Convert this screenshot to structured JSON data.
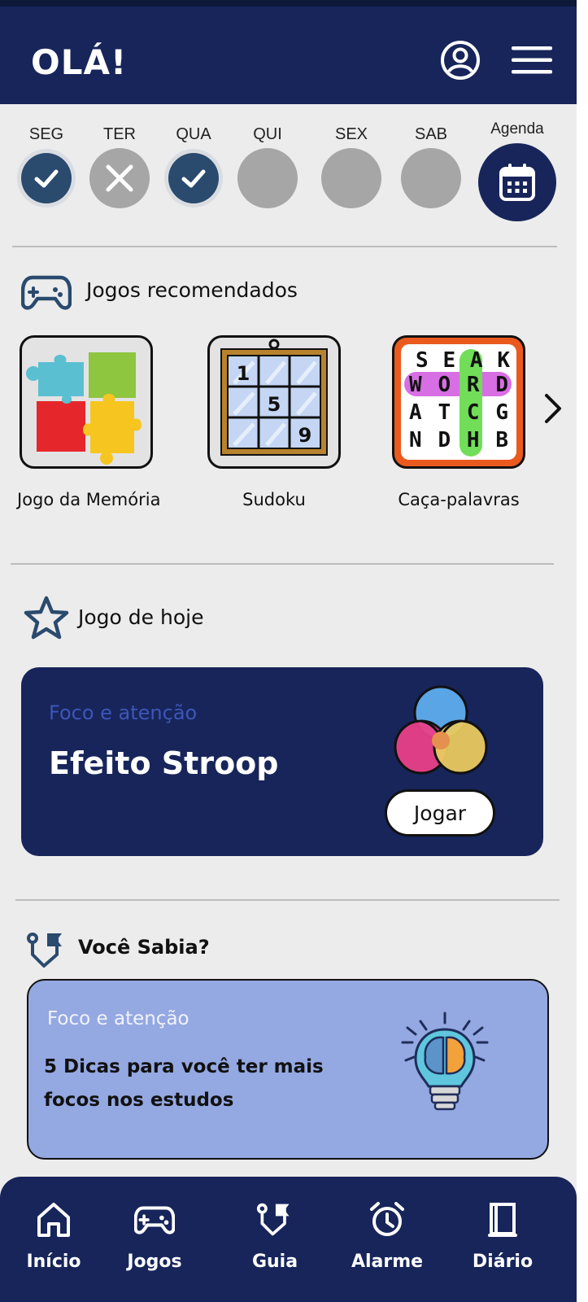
{
  "header": {
    "greeting": "OLÁ!"
  },
  "week": {
    "days": [
      {
        "label": "SEG",
        "status": "done"
      },
      {
        "label": "TER",
        "status": "missed"
      },
      {
        "label": "QUA",
        "status": "done"
      },
      {
        "label": "QUI",
        "status": "pending"
      },
      {
        "label": "SEX",
        "status": "pending"
      },
      {
        "label": "SAB",
        "status": "pending"
      }
    ],
    "agenda_label": "Agenda"
  },
  "recommended": {
    "title": "Jogos recomendados",
    "games": [
      {
        "label": "Jogo da Memória",
        "icon": "puzzle-icon"
      },
      {
        "label": "Sudoku",
        "icon": "sudoku-icon",
        "digits": [
          "1",
          "5",
          "9"
        ]
      },
      {
        "label": "Caça-palavras",
        "icon": "word-search-icon",
        "grid": [
          "SEAK",
          "WORD",
          "ATCG",
          "NDHB"
        ]
      }
    ]
  },
  "today": {
    "title": "Jogo de hoje",
    "category": "Foco e atenção",
    "name": "Efeito Stroop",
    "play_label": "Jogar"
  },
  "did_you_know": {
    "title": "Você Sabia?",
    "category": "Foco e atenção",
    "text": "5 Dicas para você ter mais focos nos estudos"
  },
  "nav": [
    {
      "label": "Início",
      "icon": "home-icon"
    },
    {
      "label": "Jogos",
      "icon": "gamepad-icon"
    },
    {
      "label": "Guia",
      "icon": "guide-icon"
    },
    {
      "label": "Alarme",
      "icon": "alarm-icon"
    },
    {
      "label": "Diário",
      "icon": "diary-icon"
    }
  ],
  "colors": {
    "primary": "#17255a",
    "background": "#ececec",
    "done": "#2a4a6e",
    "inactive": "#a6a6a6",
    "tip_card": "#94a8e2",
    "category_text": "#3d56b8"
  }
}
